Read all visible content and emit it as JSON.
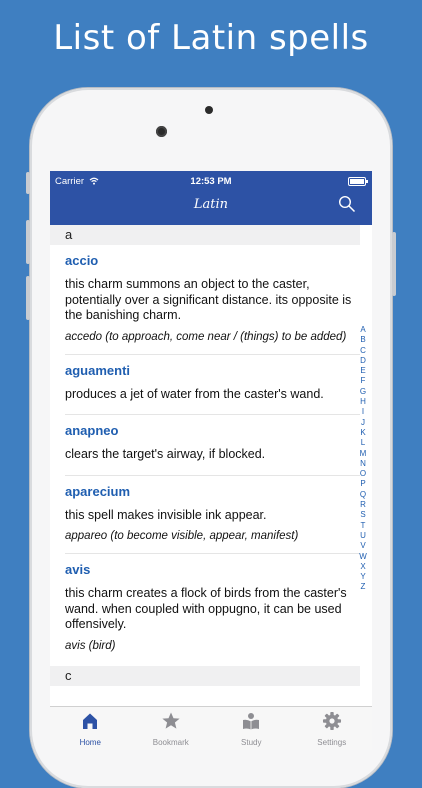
{
  "headline": "List of Latin spells",
  "status_bar": {
    "carrier": "Carrier",
    "time": "12:53 PM"
  },
  "nav": {
    "title": "Latin"
  },
  "list": {
    "sections": [
      {
        "letter": "a",
        "entries": [
          {
            "word": "accio",
            "definition": "this charm summons an object to the caster, potentially over a significant distance. its opposite is the banishing charm.",
            "etymology": "accedo (to approach, come near / (things) to be added)"
          },
          {
            "word": "aguamenti",
            "definition": "produces a jet of water from the caster's wand.",
            "etymology": ""
          },
          {
            "word": "anapneo",
            "definition": "clears the target's airway, if blocked.",
            "etymology": ""
          },
          {
            "word": "aparecium",
            "definition": "this spell makes invisible ink appear.",
            "etymology": "appareo (to become visible, appear, manifest)"
          },
          {
            "word": "avis",
            "definition": "this charm creates a flock of birds from the caster's wand. when coupled with oppugno, it can be used offensively.",
            "etymology": "avis (bird)"
          }
        ]
      },
      {
        "letter": "c",
        "entries": []
      }
    ]
  },
  "alphabet_index": [
    "A",
    "B",
    "C",
    "D",
    "E",
    "F",
    "G",
    "H",
    "I",
    "J",
    "K",
    "L",
    "M",
    "N",
    "O",
    "P",
    "Q",
    "R",
    "S",
    "T",
    "U",
    "V",
    "W",
    "X",
    "Y",
    "Z"
  ],
  "tabs": [
    {
      "label": "Home",
      "icon": "home-icon",
      "active": true
    },
    {
      "label": "Bookmark",
      "icon": "star-icon",
      "active": false
    },
    {
      "label": "Study",
      "icon": "book-reader-icon",
      "active": false
    },
    {
      "label": "Settings",
      "icon": "gear-icon",
      "active": false
    }
  ],
  "colors": {
    "background": "#3f7fc1",
    "navbar": "#2d52a5",
    "accent": "#1f5eb0",
    "tab_inactive": "#8e8e93"
  }
}
